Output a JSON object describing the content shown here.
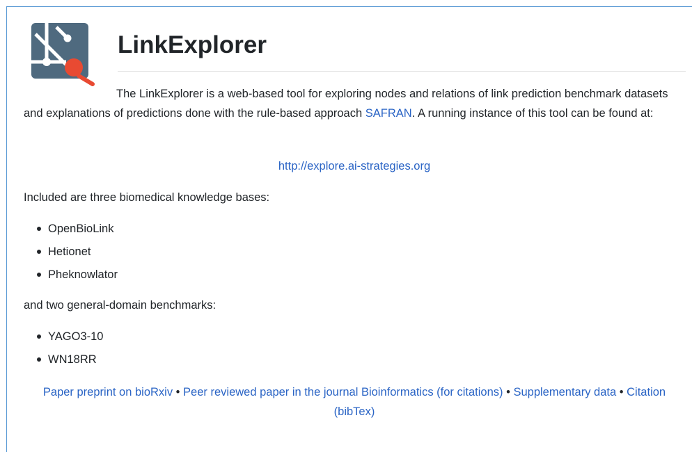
{
  "header": {
    "title": "LinkExplorer",
    "logo_icon": "link-graph-search-icon"
  },
  "intro": {
    "text_before": "The LinkExplorer is a web-based tool for exploring nodes and relations of link prediction benchmark datasets and explanations of predictions done with the rule-based approach ",
    "safran_link": "SAFRAN",
    "text_after": ". A running instance of this tool can be found at:"
  },
  "instance_url": "http://explore.ai-strategies.org",
  "biomedical": {
    "heading": "Included are three biomedical knowledge bases:",
    "items": [
      "OpenBioLink",
      "Hetionet",
      "Pheknowlator"
    ]
  },
  "general": {
    "heading": "and two general-domain benchmarks:",
    "items": [
      "YAGO3-10",
      "WN18RR"
    ]
  },
  "footer_links": {
    "preprint": "Paper preprint on bioRxiv",
    "journal": "Peer reviewed paper in the journal Bioinformatics (for citations)",
    "supplementary": "Supplementary data",
    "citation": "Citation (bibTex)",
    "separator": "•"
  },
  "colors": {
    "link": "#2a64c5",
    "logo_bg": "#4f6a7f",
    "logo_accent": "#e84a32",
    "frame": "#5b9bd5"
  }
}
